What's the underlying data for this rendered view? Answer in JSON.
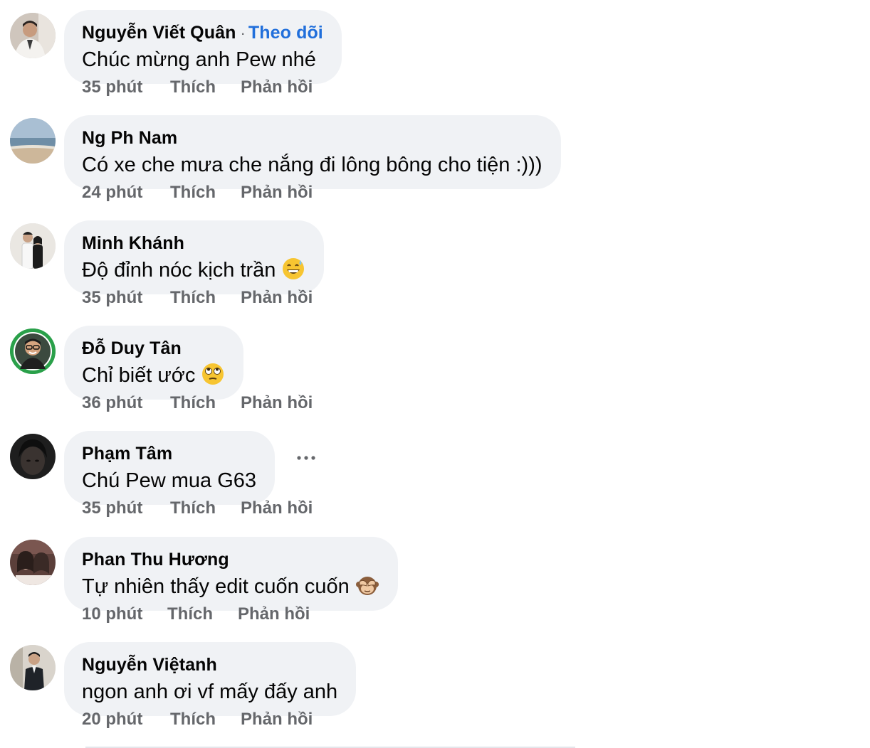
{
  "comments": [
    {
      "author": "Nguyễn Viết Quân",
      "follow_label": "Theo dõi",
      "text": "Chúc mừng anh Pew nhé",
      "time": "35 phút",
      "like": "Thích",
      "reply": "Phản hồi",
      "avatar": "avatar-man-white-suit"
    },
    {
      "author": "Ng Ph Nam",
      "text": "Có xe che mưa che nắng đi lông bông cho tiện :)))",
      "time": "24 phút",
      "like": "Thích",
      "reply": "Phản hồi",
      "avatar": "avatar-beach-landscape"
    },
    {
      "author": "Minh Khánh",
      "text": "Độ đỉnh nóc kịch trần",
      "emoji": "grinning-sweat-emoji",
      "time": "35 phút",
      "like": "Thích",
      "reply": "Phản hồi",
      "avatar": "avatar-couple"
    },
    {
      "author": "Đỗ Duy Tân",
      "text": "Chỉ biết ước",
      "emoji": "eye-roll-emoji",
      "time": "36 phút",
      "like": "Thích",
      "reply": "Phản hồi",
      "avatar": "avatar-man-glasses-green-ring"
    },
    {
      "author": "Phạm Tâm",
      "text": "Chú Pew mua G63",
      "more_icon": "ellipsis-icon",
      "time": "35 phút",
      "like": "Thích",
      "reply": "Phản hồi",
      "avatar": "avatar-dark-face"
    },
    {
      "author": "Phan Thu Hương",
      "text": "Tự nhiên thấy edit cuốn cuốn",
      "emoji": "see-no-evil-monkey-emoji",
      "time": "10 phút",
      "like": "Thích",
      "reply": "Phản hồi",
      "avatar": "avatar-two-women"
    },
    {
      "author": "Nguyễn Việtanh",
      "text": "ngon anh ơi vf mấy đấy anh",
      "time": "20 phút",
      "like": "Thích",
      "reply": "Phản hồi",
      "avatar": "avatar-man-dark-suit"
    }
  ],
  "colors": {
    "bubble": "#f0f2f5",
    "meta_text": "#65676b",
    "follow_link": "#216fdb",
    "avatar_ring": "#2aa04a"
  }
}
